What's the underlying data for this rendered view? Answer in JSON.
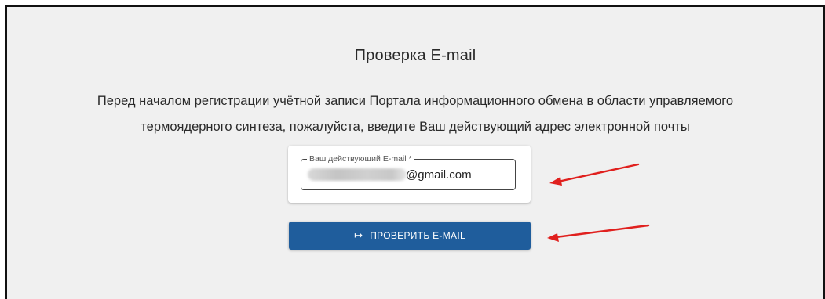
{
  "page": {
    "title": "Проверка E-mail",
    "intro_line1": "Перед началом регистрации учётной записи Портала информационного обмена в области управляемого",
    "intro_line2": "термоядерного синтеза, пожалуйста, введите Ваш действующий адрес электронной почты"
  },
  "email_field": {
    "label": "Ваш действующий E-mail *",
    "value": "@gmail.com"
  },
  "verify_button": {
    "icon": "login-arrow-icon",
    "label": "ПРОВЕРИТЬ E-MAIL"
  },
  "annotations": {
    "arrow_color": "#e0201e"
  },
  "colors": {
    "button_bg": "#1f5d9c",
    "panel_bg": "#f0f0f0"
  }
}
